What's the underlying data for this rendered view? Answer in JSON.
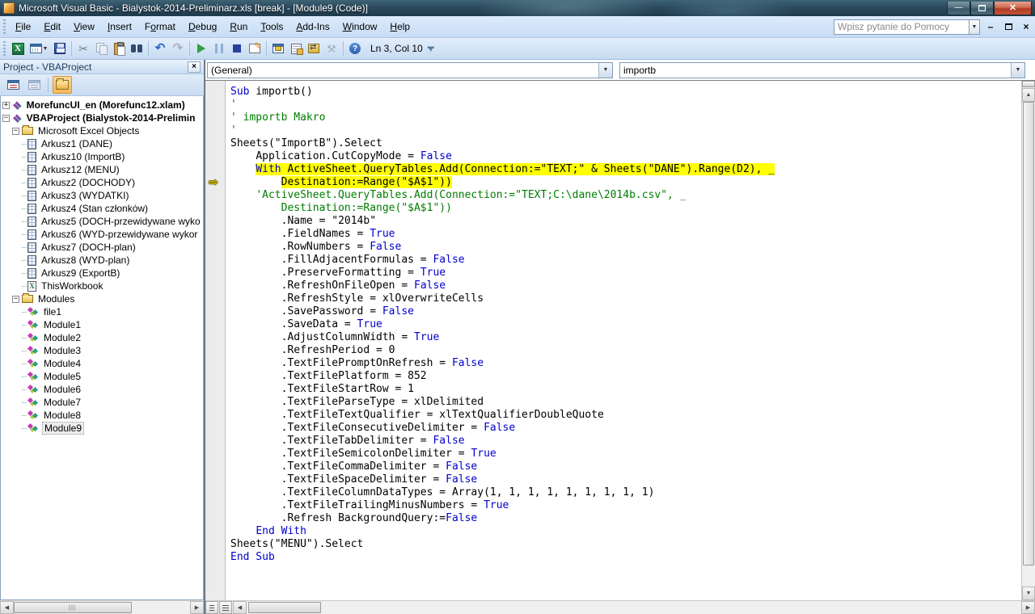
{
  "colors": {
    "highlight": "#ffff00",
    "keyword_blue": "#0000cc",
    "comment_green": "#007d00",
    "margin_arrow_yellow": "#ffd800",
    "close_button_red": "#b03c23"
  },
  "titlebar": {
    "title": "Microsoft Visual Basic - Bialystok-2014-Preliminarz.xls [break] - [Module9 (Code)]",
    "buttons": [
      "minimize",
      "restore",
      "close"
    ]
  },
  "menubar": {
    "items": [
      {
        "label": "File",
        "accel": 0
      },
      {
        "label": "Edit",
        "accel": 0
      },
      {
        "label": "View",
        "accel": 0
      },
      {
        "label": "Insert",
        "accel": 0
      },
      {
        "label": "Format",
        "accel": 1
      },
      {
        "label": "Debug",
        "accel": 0
      },
      {
        "label": "Run",
        "accel": 0
      },
      {
        "label": "Tools",
        "accel": 0
      },
      {
        "label": "Add-Ins",
        "accel": 0
      },
      {
        "label": "Window",
        "accel": 0
      },
      {
        "label": "Help",
        "accel": 0
      }
    ],
    "help_box_placeholder": "Wpisz pytanie do Pomocy",
    "mdi_buttons": [
      "minimize",
      "restore",
      "close"
    ]
  },
  "toolbar": {
    "ln_col": "Ln 3, Col 10",
    "icons": [
      "view-excel-icon",
      "insert-userform-icon",
      "save-icon",
      "cut-icon",
      "copy-icon",
      "paste-icon",
      "find-icon",
      "undo-icon",
      "redo-icon",
      "run-icon",
      "break-icon",
      "reset-icon",
      "design-mode-icon",
      "project-explorer-icon",
      "properties-window-icon",
      "object-browser-icon",
      "toolbox-icon",
      "help-icon"
    ]
  },
  "project_panel": {
    "title": "Project - VBAProject",
    "toolbar_icons": [
      "view-code-icon",
      "view-object-icon",
      "toggle-folders-icon"
    ],
    "tree": [
      {
        "level": 0,
        "exp": "+",
        "icon": "project",
        "label": "MorefuncUI_en (Morefunc12.xlam)",
        "bold": true
      },
      {
        "level": 0,
        "exp": "-",
        "icon": "project",
        "label": "VBAProject (Bialystok-2014-Prelimin",
        "bold": true
      },
      {
        "level": 1,
        "exp": "-",
        "icon": "folder",
        "label": "Microsoft Excel Objects"
      },
      {
        "level": 2,
        "exp": "",
        "icon": "sheet",
        "label": "Arkusz1 (DANE)"
      },
      {
        "level": 2,
        "exp": "",
        "icon": "sheet",
        "label": "Arkusz10 (ImportB)"
      },
      {
        "level": 2,
        "exp": "",
        "icon": "sheet",
        "label": "Arkusz12 (MENU)"
      },
      {
        "level": 2,
        "exp": "",
        "icon": "sheet",
        "label": "Arkusz2 (DOCHODY)"
      },
      {
        "level": 2,
        "exp": "",
        "icon": "sheet",
        "label": "Arkusz3 (WYDATKI)"
      },
      {
        "level": 2,
        "exp": "",
        "icon": "sheet",
        "label": "Arkusz4 (Stan członków)"
      },
      {
        "level": 2,
        "exp": "",
        "icon": "sheet",
        "label": "Arkusz5 (DOCH-przewidywane wyko"
      },
      {
        "level": 2,
        "exp": "",
        "icon": "sheet",
        "label": "Arkusz6 (WYD-przewidywane wykor"
      },
      {
        "level": 2,
        "exp": "",
        "icon": "sheet",
        "label": "Arkusz7 (DOCH-plan)"
      },
      {
        "level": 2,
        "exp": "",
        "icon": "sheet",
        "label": "Arkusz8 (WYD-plan)"
      },
      {
        "level": 2,
        "exp": "",
        "icon": "sheet",
        "label": "Arkusz9 (ExportB)"
      },
      {
        "level": 2,
        "exp": "",
        "icon": "workbook",
        "label": "ThisWorkbook"
      },
      {
        "level": 1,
        "exp": "-",
        "icon": "folder",
        "label": "Modules"
      },
      {
        "level": 2,
        "exp": "",
        "icon": "module",
        "label": "file1"
      },
      {
        "level": 2,
        "exp": "",
        "icon": "module",
        "label": "Module1"
      },
      {
        "level": 2,
        "exp": "",
        "icon": "module",
        "label": "Module2"
      },
      {
        "level": 2,
        "exp": "",
        "icon": "module",
        "label": "Module3"
      },
      {
        "level": 2,
        "exp": "",
        "icon": "module",
        "label": "Module4"
      },
      {
        "level": 2,
        "exp": "",
        "icon": "module",
        "label": "Module5"
      },
      {
        "level": 2,
        "exp": "",
        "icon": "module",
        "label": "Module6"
      },
      {
        "level": 2,
        "exp": "",
        "icon": "module",
        "label": "Module7"
      },
      {
        "level": 2,
        "exp": "",
        "icon": "module",
        "label": "Module8"
      },
      {
        "level": 2,
        "exp": "",
        "icon": "module",
        "label": "Module9",
        "selected": true
      }
    ]
  },
  "code_window": {
    "object_combo": "(General)",
    "procedure_combo": "importb",
    "lines": [
      {
        "pre": "",
        "segs": [
          [
            "kw",
            "Sub"
          ],
          [
            "tx",
            " importb()"
          ]
        ]
      },
      {
        "pre": "",
        "segs": [
          [
            "cm",
            "'"
          ]
        ]
      },
      {
        "pre": "",
        "segs": [
          [
            "cm",
            "' importb Makro"
          ]
        ]
      },
      {
        "pre": "",
        "segs": [
          [
            "cm",
            "'"
          ]
        ]
      },
      {
        "pre": "",
        "segs": [
          [
            "tx",
            "Sheets(\"ImportB\").Select"
          ]
        ]
      },
      {
        "pre": "    ",
        "segs": [
          [
            "tx",
            "Application.CutCopyMode = "
          ],
          [
            "kw",
            "False"
          ]
        ]
      },
      {
        "pre": "    ",
        "hl": true,
        "segs": [
          [
            "kw",
            "With"
          ],
          [
            "tx",
            " ActiveSheet.QueryTables.Add(Connection:=\"TEXT;\" & Sheets(\"DANE\").Range(D2), _"
          ]
        ]
      },
      {
        "pre": "        ",
        "hl": true,
        "arrow": true,
        "segs": [
          [
            "tx",
            "Destination:=Range(\"$A$1\"))"
          ]
        ]
      },
      {
        "pre": "    ",
        "segs": [
          [
            "cm",
            "'ActiveSheet.QueryTables.Add(Connection:=\"TEXT;C:\\dane\\2014b.csv\", _"
          ]
        ]
      },
      {
        "pre": "        ",
        "segs": [
          [
            "cm",
            "Destination:=Range(\"$A$1\"))"
          ]
        ]
      },
      {
        "pre": "        ",
        "segs": [
          [
            "tx",
            ".Name = \"2014b\""
          ]
        ]
      },
      {
        "pre": "        ",
        "segs": [
          [
            "tx",
            ".FieldNames = "
          ],
          [
            "kw",
            "True"
          ]
        ]
      },
      {
        "pre": "        ",
        "segs": [
          [
            "tx",
            ".RowNumbers = "
          ],
          [
            "kw",
            "False"
          ]
        ]
      },
      {
        "pre": "        ",
        "segs": [
          [
            "tx",
            ".FillAdjacentFormulas = "
          ],
          [
            "kw",
            "False"
          ]
        ]
      },
      {
        "pre": "        ",
        "segs": [
          [
            "tx",
            ".PreserveFormatting = "
          ],
          [
            "kw",
            "True"
          ]
        ]
      },
      {
        "pre": "        ",
        "segs": [
          [
            "tx",
            ".RefreshOnFileOpen = "
          ],
          [
            "kw",
            "False"
          ]
        ]
      },
      {
        "pre": "        ",
        "segs": [
          [
            "tx",
            ".RefreshStyle = xlOverwriteCells"
          ]
        ]
      },
      {
        "pre": "        ",
        "segs": [
          [
            "tx",
            ".SavePassword = "
          ],
          [
            "kw",
            "False"
          ]
        ]
      },
      {
        "pre": "        ",
        "segs": [
          [
            "tx",
            ".SaveData = "
          ],
          [
            "kw",
            "True"
          ]
        ]
      },
      {
        "pre": "        ",
        "segs": [
          [
            "tx",
            ".AdjustColumnWidth = "
          ],
          [
            "kw",
            "True"
          ]
        ]
      },
      {
        "pre": "        ",
        "segs": [
          [
            "tx",
            ".RefreshPeriod = 0"
          ]
        ]
      },
      {
        "pre": "        ",
        "segs": [
          [
            "tx",
            ".TextFilePromptOnRefresh = "
          ],
          [
            "kw",
            "False"
          ]
        ]
      },
      {
        "pre": "        ",
        "segs": [
          [
            "tx",
            ".TextFilePlatform = 852"
          ]
        ]
      },
      {
        "pre": "        ",
        "segs": [
          [
            "tx",
            ".TextFileStartRow = 1"
          ]
        ]
      },
      {
        "pre": "        ",
        "segs": [
          [
            "tx",
            ".TextFileParseType = xlDelimited"
          ]
        ]
      },
      {
        "pre": "        ",
        "segs": [
          [
            "tx",
            ".TextFileTextQualifier = xlTextQualifierDoubleQuote"
          ]
        ]
      },
      {
        "pre": "        ",
        "segs": [
          [
            "tx",
            ".TextFileConsecutiveDelimiter = "
          ],
          [
            "kw",
            "False"
          ]
        ]
      },
      {
        "pre": "        ",
        "segs": [
          [
            "tx",
            ".TextFileTabDelimiter = "
          ],
          [
            "kw",
            "False"
          ]
        ]
      },
      {
        "pre": "        ",
        "segs": [
          [
            "tx",
            ".TextFileSemicolonDelimiter = "
          ],
          [
            "kw",
            "True"
          ]
        ]
      },
      {
        "pre": "        ",
        "segs": [
          [
            "tx",
            ".TextFileCommaDelimiter = "
          ],
          [
            "kw",
            "False"
          ]
        ]
      },
      {
        "pre": "        ",
        "segs": [
          [
            "tx",
            ".TextFileSpaceDelimiter = "
          ],
          [
            "kw",
            "False"
          ]
        ]
      },
      {
        "pre": "        ",
        "segs": [
          [
            "tx",
            ".TextFileColumnDataTypes = Array(1, 1, 1, 1, 1, 1, 1, 1, 1)"
          ]
        ]
      },
      {
        "pre": "        ",
        "segs": [
          [
            "tx",
            ".TextFileTrailingMinusNumbers = "
          ],
          [
            "kw",
            "True"
          ]
        ]
      },
      {
        "pre": "        ",
        "segs": [
          [
            "tx",
            ".Refresh BackgroundQuery:="
          ],
          [
            "kw",
            "False"
          ]
        ]
      },
      {
        "pre": "    ",
        "segs": [
          [
            "kw",
            "End With"
          ]
        ]
      },
      {
        "pre": "",
        "segs": [
          [
            "tx",
            "Sheets(\"MENU\").Select"
          ]
        ]
      },
      {
        "pre": "",
        "segs": [
          [
            "kw",
            "End Sub"
          ]
        ]
      }
    ]
  }
}
